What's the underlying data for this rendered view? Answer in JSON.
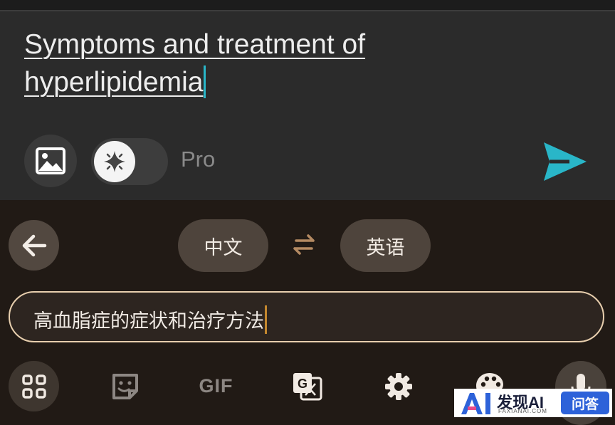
{
  "compose": {
    "query_text": "Symptoms and treatment of hyperlipidemia",
    "image_icon": "image-icon",
    "toggle_icon": "sparkle-icon",
    "pro_label": "Pro",
    "send_icon": "send-icon",
    "accent_color": "#29b6c8"
  },
  "translate_bar": {
    "back_icon": "arrow-left-icon",
    "source_language": "中文",
    "swap_icon": "swap-arrows-icon",
    "target_language": "英语",
    "input_text": "高血脂症的症状和治疗方法",
    "border_color": "#e8cfae"
  },
  "keyboard_toolbar": {
    "apps_icon": "apps-grid-icon",
    "sticker_icon": "sticker-icon",
    "gif_label": "GIF",
    "translate_icon": "translate-icon",
    "settings_icon": "gear-icon",
    "theme_icon": "palette-icon",
    "mic_icon": "microphone-icon"
  },
  "watermark": {
    "logo_text": "AI",
    "brand": "发现AI",
    "domain": "FAXIANAI.COM",
    "badge": "问答"
  }
}
